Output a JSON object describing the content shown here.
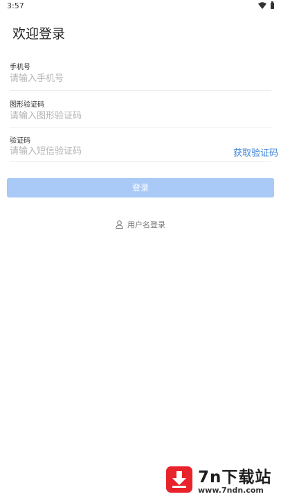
{
  "status_bar": {
    "time": "3:57"
  },
  "page": {
    "title": "欢迎登录"
  },
  "form": {
    "phone": {
      "label": "手机号",
      "placeholder": "请输入手机号",
      "value": ""
    },
    "captcha": {
      "label": "图形验证码",
      "placeholder": "请输入图形验证码",
      "value": ""
    },
    "sms": {
      "label": "验证码",
      "placeholder": "请输入短信验证码",
      "value": "",
      "get_code_label": "获取验证码"
    },
    "login_button_label": "登录"
  },
  "alt_login": {
    "label": "用户名登录",
    "icon": "user-icon"
  },
  "watermark": {
    "title": "7n下载站",
    "url": "www.7ndn.com",
    "icon": "download-arrow-icon"
  },
  "colors": {
    "primary_disabled": "#a9c9f6",
    "link": "#3d86d8",
    "watermark_red": "#e8232b"
  }
}
